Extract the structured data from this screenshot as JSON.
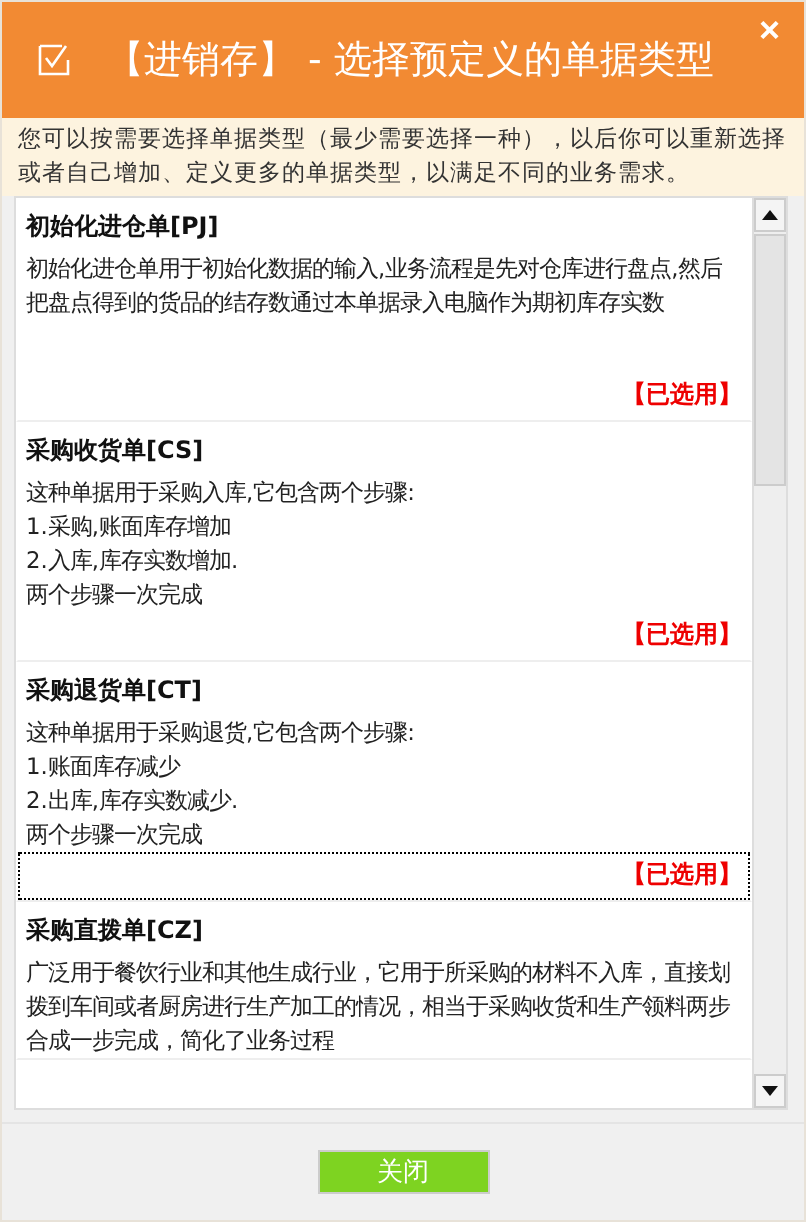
{
  "window": {
    "title": "【进销存】 - 选择预定义的单据类型",
    "close": "×"
  },
  "notice": "您可以按需要选择单据类型（最少需要选择一种），以后你可以重新选择或者自己增加、定义更多的单据类型，以满足不同的业务需求。",
  "items": [
    {
      "title": "初始化进仓单[PJ]",
      "lines": [
        "初始化进仓单用于初始化数据的输入,业务流程是先对仓库进行盘点,然后把盘点得到的货品的结存数通过本单据录入电脑作为期初库存实数"
      ],
      "status": "【已选用】",
      "focused": false
    },
    {
      "title": "采购收货单[CS]",
      "lines": [
        "这种单据用于采购入库,它包含两个步骤:",
        "1.采购,账面库存增加",
        "2.入库,库存实数增加.",
        "两个步骤一次完成"
      ],
      "status": "【已选用】",
      "focused": false
    },
    {
      "title": "采购退货单[CT]",
      "lines": [
        "这种单据用于采购退货,它包含两个步骤:",
        "1.账面库存减少",
        "2.出库,库存实数减少.",
        "两个步骤一次完成"
      ],
      "status": "【已选用】",
      "focused": true
    },
    {
      "title": "采购直拨单[CZ]",
      "lines": [
        "广泛用于餐饮行业和其他生成行业，它用于所采购的材料不入库，直接划拨到车间或者厨房进行生产加工的情况，相当于采购收货和生产领料两步合成一步完成，简化了业务过程"
      ],
      "focused": false
    }
  ],
  "button": "关闭"
}
